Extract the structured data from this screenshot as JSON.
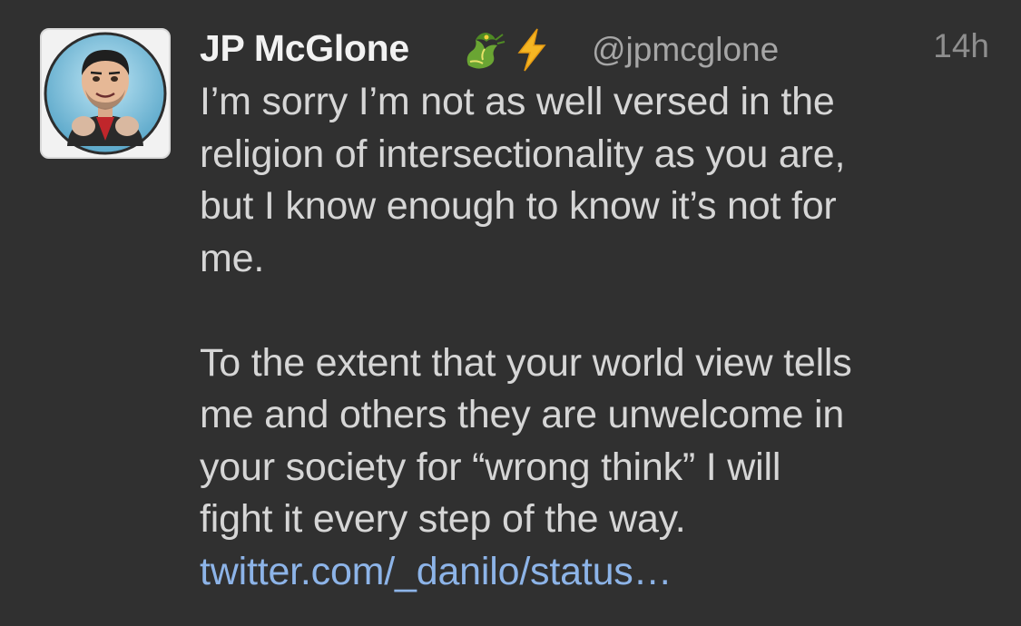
{
  "tweet": {
    "display_name": "JP McGlone",
    "name_emojis": [
      "dragon-emoji",
      "high-voltage-emoji"
    ],
    "handle": "@jpmcglone",
    "time": "14h",
    "paragraph_1": [
      "I’m sorry I’m not as well versed in the",
      "religion of intersectionality as you are,",
      "but I know enough to know it’s not for",
      "me."
    ],
    "paragraph_2": [
      "To the extent that your world view tells",
      "me and others they are unwelcome in",
      "your society for “wrong think” I will",
      "fight it every step of the way."
    ],
    "link_text": "twitter.com/_danilo/status…"
  },
  "colors": {
    "background": "#303030",
    "name": "#f2f2f2",
    "body_text": "#d6d6d6",
    "handle": "#a6a6a6",
    "timestamp": "#8e8e8e",
    "link": "#8db4e8"
  }
}
